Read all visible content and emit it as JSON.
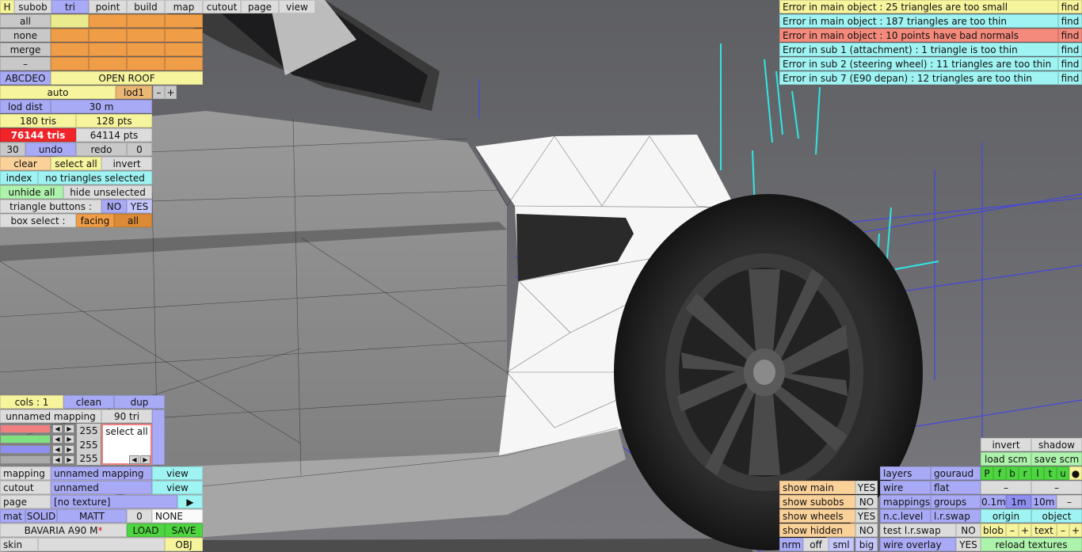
{
  "topbar": {
    "h": "H",
    "tabs": [
      "subob",
      "tri",
      "point",
      "build",
      "map",
      "cutout",
      "page",
      "view"
    ]
  },
  "select_rows": [
    "all",
    "none",
    "merge",
    "–"
  ],
  "colors": {
    "orange": "#ef9d47",
    "yellow": "#f6f49c",
    "blue": "#a9aaf5",
    "cyan": "#9ff3f3",
    "red": "#f1242a",
    "green": "#4ed640",
    "salmon": "#f48a7b"
  },
  "object_bar": {
    "name_btn": "ABCDEO",
    "roof": "OPEN ROOF"
  },
  "lod": {
    "auto": "auto",
    "lod": "lod1",
    "minus": "–",
    "plus": "+",
    "dist_label": "lod dist",
    "dist_value": "30 m",
    "tris": "180 tris",
    "pts": "128 pts",
    "total_tris": "76144 tris",
    "total_pts": "64114 pts"
  },
  "undo": {
    "count": "30",
    "undo": "undo",
    "redo": "redo",
    "redo_count": "0"
  },
  "select": {
    "clear": "clear",
    "select_all": "select all",
    "invert": "invert",
    "index": "index",
    "status": "no triangles selected",
    "unhide_all": "unhide all",
    "hide_unselected": "hide unselected"
  },
  "tri_buttons": {
    "label": "triangle buttons :",
    "no": "NO",
    "yes": "YES"
  },
  "box_select": {
    "label": "box select :",
    "facing": "facing",
    "all": "all"
  },
  "errors": [
    {
      "text": "Error in main object : 25 triangles are too small",
      "find": "find"
    },
    {
      "text": "Error in main object : 187 triangles are too thin",
      "find": "find"
    },
    {
      "text": "Error in main object : 10 points have bad normals",
      "find": "find"
    },
    {
      "text": "Error in sub 1 (attachment) : 1 triangle is too thin",
      "find": "find"
    },
    {
      "text": "Error in sub 2 (steering wheel) : 11 triangles are too thin",
      "find": "find"
    },
    {
      "text": "Error in sub 7 (E90 depan) : 12 triangles are too thin",
      "find": "find"
    }
  ],
  "mat_panel": {
    "cols": "cols : 1",
    "clean": "clean",
    "dup": "dup",
    "mapping_name": "unnamed mapping",
    "mapping_tris": "90 tri",
    "rgb": [
      "255",
      "255",
      "255"
    ],
    "select_all": "select all",
    "mapping_label": "mapping",
    "mapping_value": "unnamed mapping",
    "view": "view",
    "cutout_label": "cutout",
    "cutout_value": "unnamed",
    "page_label": "page",
    "page_value": "[no texture]",
    "page_arrow": "▶",
    "mat": "mat",
    "solid": "SOLID",
    "matt": "MATT",
    "zero": "0",
    "none": "NONE",
    "car": "BAVARIA A90 M",
    "star": "*",
    "load": "LOAD",
    "save": "SAVE",
    "skin": "skin",
    "obj": "OBJ"
  },
  "view_panel": {
    "show_main": "show main",
    "show_subobs": "show subobs",
    "show_wheels": "show wheels",
    "show_hidden": "show hidden",
    "yes": "YES",
    "no": "NO",
    "nrm": "nrm",
    "off": "off",
    "sml": "sml",
    "big": "big",
    "layers": "layers",
    "gouraud": "gouraud",
    "wire": "wire",
    "flat": "flat",
    "mappings": "mappings",
    "groups": "groups",
    "nclevel": "n.c.level",
    "lrswap": "l.r.swap",
    "test_lrswap": "test l.r.swap",
    "wire_overlay": "wire overlay",
    "invert": "invert",
    "shadow": "shadow",
    "load_scm": "load scm",
    "save_scm": "save scm",
    "letters": [
      "P",
      "f",
      "b",
      "r",
      "l",
      "t",
      "u",
      "●"
    ],
    "dash": "–",
    "d01": "0.1m",
    "d1": "1m",
    "d10": "10m",
    "origin": "origin",
    "object": "object",
    "blob": "blob",
    "text": "text",
    "minus": "–",
    "plus": "+",
    "reload": "reload textures"
  }
}
